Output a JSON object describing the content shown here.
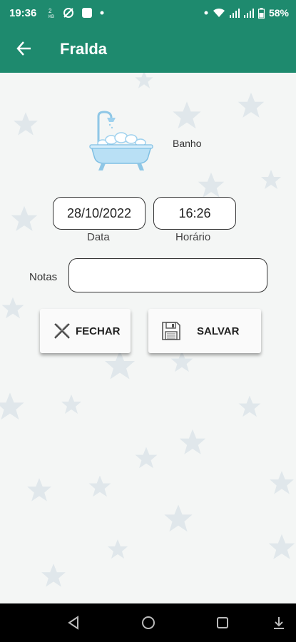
{
  "status": {
    "time": "19:36",
    "battery": "58%",
    "left_icons": [
      "sim-icon",
      "no-sync-icon",
      "app-icon",
      "dot-icon"
    ],
    "right_icons": [
      "dot-icon",
      "wifi-icon",
      "signal-icon",
      "signal-icon",
      "battery-icon"
    ]
  },
  "appbar": {
    "title": "Fralda",
    "back_icon": "arrow-left-icon"
  },
  "activity": {
    "label": "Banho",
    "icon": "bathtub-icon"
  },
  "form": {
    "date_value": "28/10/2022",
    "date_label": "Data",
    "time_value": "16:26",
    "time_label": "Horário",
    "notes_label": "Notas",
    "notes_value": ""
  },
  "buttons": {
    "close_label": "FECHAR",
    "close_icon": "x-icon",
    "save_label": "SALVAR",
    "save_icon": "floppy-disk-icon"
  },
  "navbar": [
    "back-triangle-icon",
    "home-circle-icon",
    "recents-square-icon",
    "download-icon"
  ],
  "colors": {
    "primary": "#1e8a6e",
    "background": "#f4f6f5",
    "star": "#b9ccd9"
  }
}
